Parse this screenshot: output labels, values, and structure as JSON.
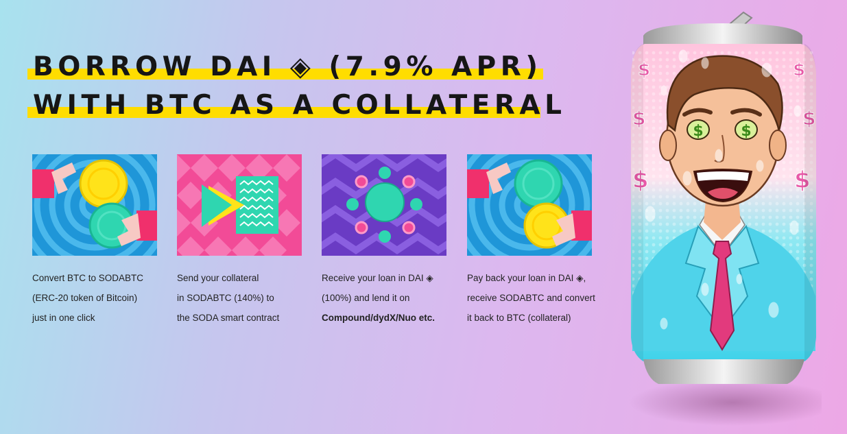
{
  "headline": {
    "line1": "BORROW DAI ◈ (7.9% APR)",
    "line2": "WITH BTC AS A COLLATERAL"
  },
  "colors": {
    "highlight": "#ffdd00",
    "step1_bg": "#1f96d8",
    "step2_bg": "#f24b97",
    "step3_bg": "#6a3bc4",
    "step4_bg": "#1f96d8"
  },
  "steps": [
    {
      "icon": "btc-to-sodabtc-exchange-icon",
      "lines": [
        "Convert BTC to SODABTC",
        "(ERC-20 token of Bitcoin)",
        "just in one click"
      ]
    },
    {
      "icon": "send-collateral-contract-icon",
      "lines": [
        "Send your collateral",
        "in SODABTC (140%) to",
        "the SODA smart contract"
      ]
    },
    {
      "icon": "receive-loan-network-icon",
      "lines": [
        "Receive your loan in DAI ◈",
        "(100%) and lend it on"
      ],
      "bold_line": "Compound/dydX/Nuo etc."
    },
    {
      "icon": "payback-loan-exchange-icon",
      "lines": [
        "Pay back your loan in DAI ◈,",
        "receive SODABTC and convert",
        "it back to BTC (collateral)"
      ]
    }
  ],
  "illustration": {
    "icon": "soda-can-man-illustration",
    "symbols": [
      "$",
      "$",
      "$",
      "$",
      "$",
      "$"
    ]
  }
}
